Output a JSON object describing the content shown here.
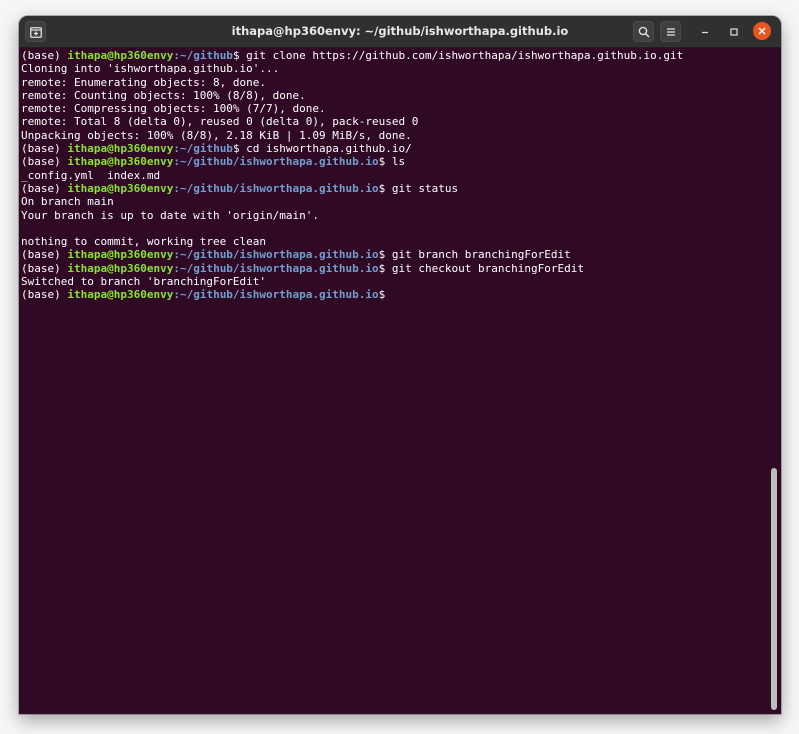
{
  "window": {
    "title": "ithapa@hp360envy: ~/github/ishworthapa.github.io"
  },
  "titlebar": {
    "new_tab_icon": "new-tab-icon",
    "search_icon": "search-icon",
    "menu_icon": "hamburger-menu-icon",
    "minimize_icon": "minimize-icon",
    "maximize_icon": "maximize-icon",
    "close_icon": "close-icon"
  },
  "colors": {
    "terminal_bg": "#300a24",
    "user_host": "#8ae234",
    "path": "#729fcf",
    "text": "#ffffff",
    "close_button": "#e95420",
    "titlebar_bg": "#303030"
  },
  "terminal": {
    "lines": [
      {
        "type": "prompt",
        "prefix": "(base) ",
        "user": "ithapa@hp360envy",
        "sep": ":",
        "path": "~/github",
        "cmd": "$ git clone https://github.com/ishworthapa/ishworthapa.github.io.git"
      },
      {
        "type": "output",
        "text": "Cloning into 'ishworthapa.github.io'..."
      },
      {
        "type": "output",
        "text": "remote: Enumerating objects: 8, done."
      },
      {
        "type": "output",
        "text": "remote: Counting objects: 100% (8/8), done."
      },
      {
        "type": "output",
        "text": "remote: Compressing objects: 100% (7/7), done."
      },
      {
        "type": "output",
        "text": "remote: Total 8 (delta 0), reused 0 (delta 0), pack-reused 0"
      },
      {
        "type": "output",
        "text": "Unpacking objects: 100% (8/8), 2.18 KiB | 1.09 MiB/s, done."
      },
      {
        "type": "prompt",
        "prefix": "(base) ",
        "user": "ithapa@hp360envy",
        "sep": ":",
        "path": "~/github",
        "cmd": "$ cd ishworthapa.github.io/"
      },
      {
        "type": "prompt",
        "prefix": "(base) ",
        "user": "ithapa@hp360envy",
        "sep": ":",
        "path": "~/github/ishworthapa.github.io",
        "cmd": "$ ls"
      },
      {
        "type": "output",
        "text": "_config.yml  index.md"
      },
      {
        "type": "prompt",
        "prefix": "(base) ",
        "user": "ithapa@hp360envy",
        "sep": ":",
        "path": "~/github/ishworthapa.github.io",
        "cmd": "$ git status"
      },
      {
        "type": "output",
        "text": "On branch main"
      },
      {
        "type": "output",
        "text": "Your branch is up to date with 'origin/main'."
      },
      {
        "type": "output",
        "text": ""
      },
      {
        "type": "output",
        "text": "nothing to commit, working tree clean"
      },
      {
        "type": "prompt",
        "prefix": "(base) ",
        "user": "ithapa@hp360envy",
        "sep": ":",
        "path": "~/github/ishworthapa.github.io",
        "cmd": "$ git branch branchingForEdit"
      },
      {
        "type": "prompt",
        "prefix": "(base) ",
        "user": "ithapa@hp360envy",
        "sep": ":",
        "path": "~/github/ishworthapa.github.io",
        "cmd": "$ git checkout branchingForEdit"
      },
      {
        "type": "output",
        "text": "Switched to branch 'branchingForEdit'"
      },
      {
        "type": "prompt",
        "prefix": "(base) ",
        "user": "ithapa@hp360envy",
        "sep": ":",
        "path": "~/github/ishworthapa.github.io",
        "cmd": "$ "
      }
    ]
  }
}
